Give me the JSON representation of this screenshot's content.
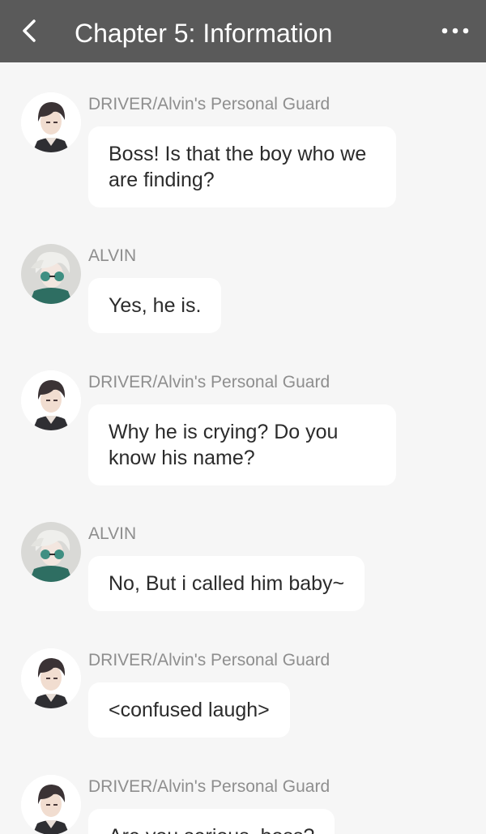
{
  "header": {
    "title": "Chapter 5: Information",
    "back_icon": "chevron-left-icon",
    "more_icon": "more-horizontal-icon",
    "bg_color": "#5a5a5a"
  },
  "messages": [
    {
      "speaker": "DRIVER/Alvin's Personal Guard",
      "text": "Boss! Is that the boy who we are finding?",
      "avatar": "driver"
    },
    {
      "speaker": "ALVIN",
      "text": "Yes, he is.",
      "avatar": "alvin"
    },
    {
      "speaker": "DRIVER/Alvin's Personal Guard",
      "text": "Why he is crying? Do you know his name?",
      "avatar": "driver"
    },
    {
      "speaker": "ALVIN",
      "text": "No, But i called him baby~",
      "avatar": "alvin"
    },
    {
      "speaker": "DRIVER/Alvin's Personal Guard",
      "text": "<confused laugh>",
      "avatar": "driver"
    },
    {
      "speaker": "DRIVER/Alvin's Personal Guard",
      "text": "Are you serious, boss?",
      "avatar": "driver"
    }
  ]
}
